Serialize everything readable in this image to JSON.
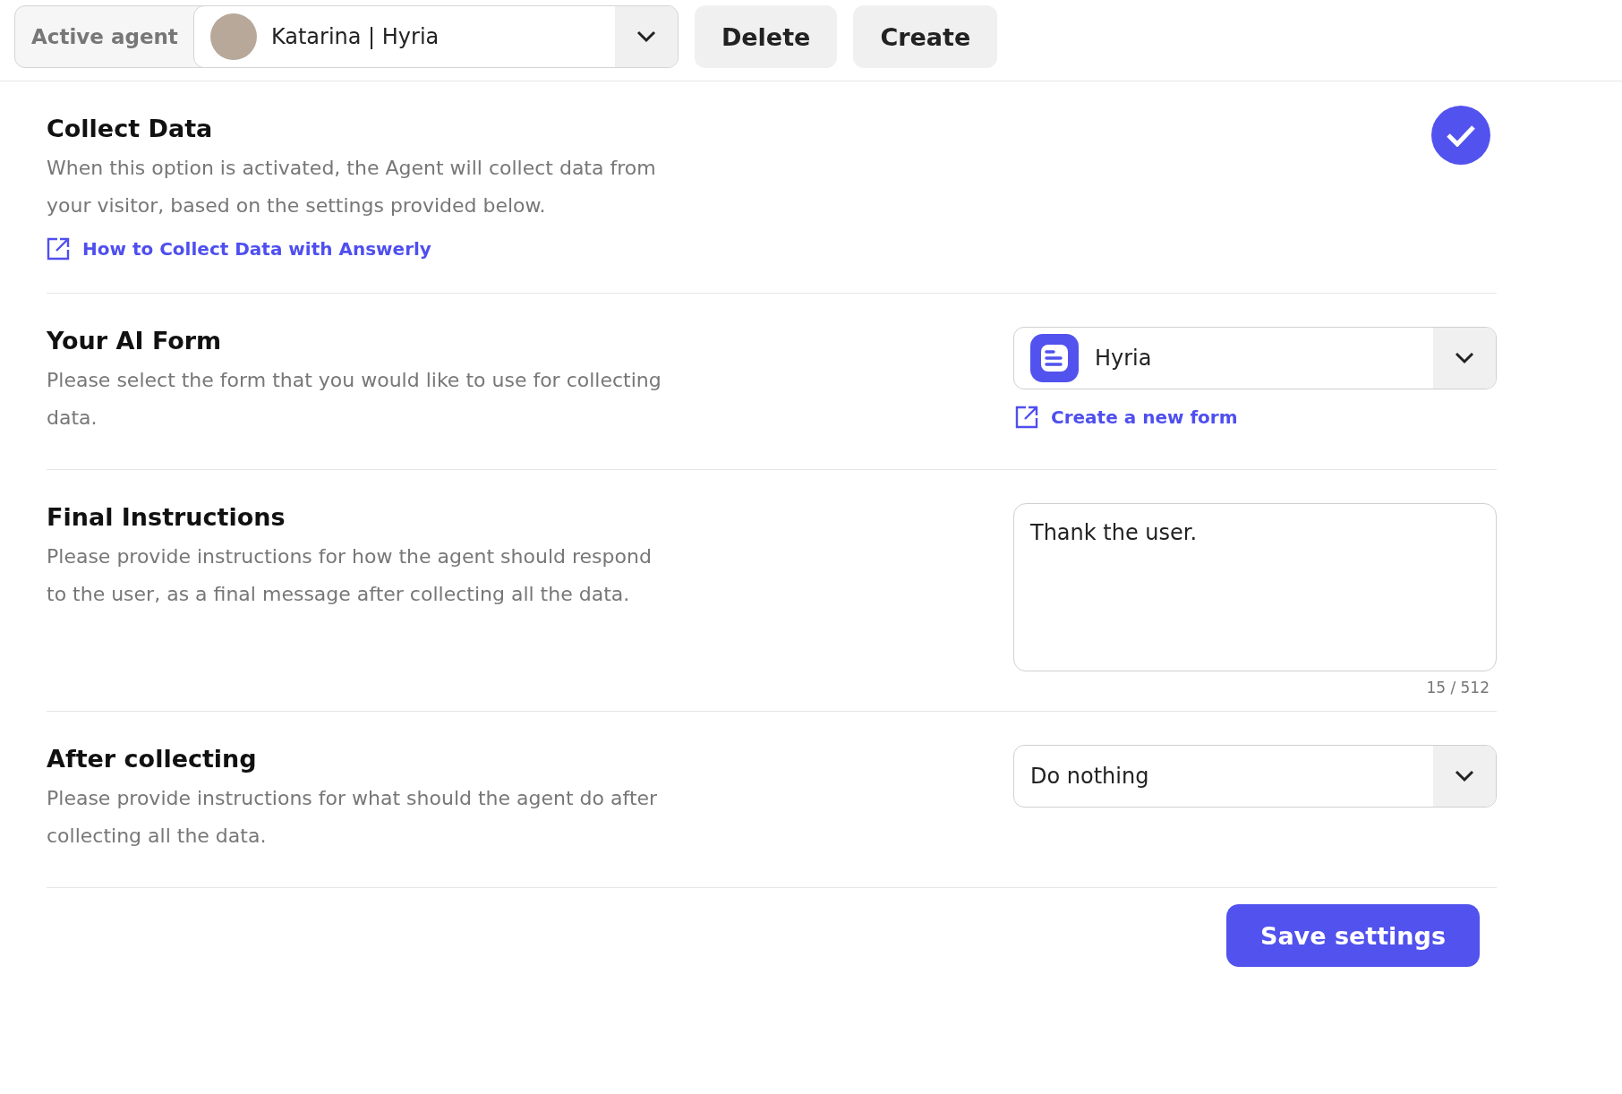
{
  "agent_bar": {
    "label": "Active agent",
    "agent": "Katarina | Hyria",
    "buttons": [
      "Delete",
      "Create"
    ]
  },
  "sections": [
    {
      "kind": "toggle",
      "title": "Collect Data",
      "description": "When this option is activated, the Agent will collect data from your visitor, based on the settings provided below.",
      "link": "How to Collect Data with Answerly",
      "checked": true
    },
    {
      "kind": "form_select",
      "title": "Your AI Form",
      "description": "Please select the form that you would like to use for collecting data.",
      "value": "Hyria",
      "link": "Create a new form"
    },
    {
      "kind": "textarea",
      "title": "Final Instructions",
      "description": "Please provide instructions for how the agent should respond to the user, as a final message after collecting all the data.",
      "value": "Thank the user.",
      "counter": "15 / 512"
    },
    {
      "kind": "select",
      "title": "After collecting",
      "description": "Please provide instructions for what should the agent do after collecting all the data.",
      "value": "Do nothing"
    }
  ],
  "save_button": "Save settings"
}
